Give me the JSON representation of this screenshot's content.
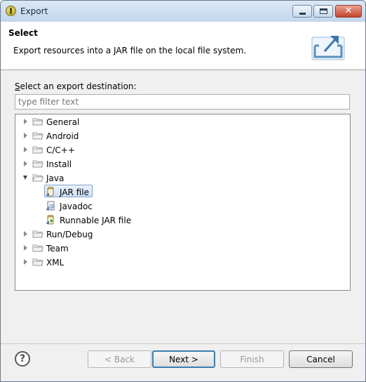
{
  "window": {
    "title": "Export"
  },
  "header": {
    "title": "Select",
    "description": "Export resources into a JAR file on the local file system."
  },
  "destination_label_accel": "S",
  "destination_label_rest": "elect an export destination:",
  "filter": {
    "placeholder": "type filter text",
    "value": ""
  },
  "tree": {
    "general": "General",
    "android": "Android",
    "cpp": "C/C++",
    "install": "Install",
    "java": "Java",
    "jar_file": "JAR file",
    "javadoc": "Javadoc",
    "runnable_jar": "Runnable JAR file",
    "run_debug": "Run/Debug",
    "team": "Team",
    "xml": "XML"
  },
  "buttons": {
    "help": "?",
    "back": "< Back",
    "next": "Next >",
    "finish": "Finish",
    "cancel": "Cancel"
  }
}
